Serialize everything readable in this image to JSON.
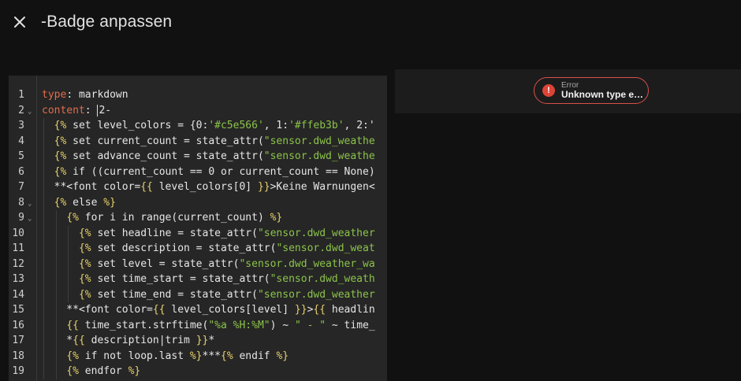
{
  "header": {
    "close_icon": "close-icon",
    "title": "-Badge anpassen"
  },
  "editor": {
    "lines": [
      {
        "num": "1",
        "fold": "",
        "segments": [
          {
            "c": "k",
            "t": "type"
          },
          {
            "c": "",
            "t": ": markdown"
          }
        ]
      },
      {
        "num": "2",
        "fold": "⌄",
        "segments": [
          {
            "c": "k",
            "t": "content"
          },
          {
            "c": "",
            "t": ": "
          },
          {
            "c": "cursor",
            "t": ""
          },
          {
            "c": "",
            "t": "2-"
          }
        ]
      },
      {
        "num": "3",
        "fold": "",
        "segments": [
          {
            "c": "",
            "t": "  "
          },
          {
            "c": "y",
            "t": "{%"
          },
          {
            "c": "",
            "t": " set level_colors = {0:"
          },
          {
            "c": "s",
            "t": "'#c5e566'"
          },
          {
            "c": "",
            "t": ", 1:"
          },
          {
            "c": "s",
            "t": "'#ffeb3b'"
          },
          {
            "c": "",
            "t": ", 2:'"
          }
        ]
      },
      {
        "num": "4",
        "fold": "",
        "segments": [
          {
            "c": "",
            "t": "  "
          },
          {
            "c": "y",
            "t": "{%"
          },
          {
            "c": "",
            "t": " set current_count = state_attr("
          },
          {
            "c": "s",
            "t": "\"sensor.dwd_weathe"
          }
        ]
      },
      {
        "num": "5",
        "fold": "",
        "segments": [
          {
            "c": "",
            "t": "  "
          },
          {
            "c": "y",
            "t": "{%"
          },
          {
            "c": "",
            "t": " set advance_count = state_attr("
          },
          {
            "c": "s",
            "t": "\"sensor.dwd_weathe"
          }
        ]
      },
      {
        "num": "6",
        "fold": "",
        "segments": [
          {
            "c": "",
            "t": "  "
          },
          {
            "c": "y",
            "t": "{%"
          },
          {
            "c": "",
            "t": " if ((current_count == 0 or current_count == None)"
          }
        ]
      },
      {
        "num": "7",
        "fold": "",
        "segments": [
          {
            "c": "",
            "t": "  **<font color="
          },
          {
            "c": "y",
            "t": "{{"
          },
          {
            "c": "",
            "t": " level_colors[0] "
          },
          {
            "c": "y",
            "t": "}}"
          },
          {
            "c": "",
            "t": ">Keine Warnungen<"
          }
        ]
      },
      {
        "num": "8",
        "fold": "⌄",
        "segments": [
          {
            "c": "",
            "t": "  "
          },
          {
            "c": "y",
            "t": "{%"
          },
          {
            "c": "",
            "t": " else "
          },
          {
            "c": "y",
            "t": "%}"
          }
        ]
      },
      {
        "num": "9",
        "fold": "⌄",
        "segments": [
          {
            "c": "",
            "t": "    "
          },
          {
            "c": "y",
            "t": "{%"
          },
          {
            "c": "",
            "t": " for i in range(current_count) "
          },
          {
            "c": "y",
            "t": "%}"
          }
        ]
      },
      {
        "num": "10",
        "fold": "",
        "segments": [
          {
            "c": "",
            "t": "      "
          },
          {
            "c": "y",
            "t": "{%"
          },
          {
            "c": "",
            "t": " set headline = state_attr("
          },
          {
            "c": "s",
            "t": "\"sensor.dwd_weather"
          }
        ]
      },
      {
        "num": "11",
        "fold": "",
        "segments": [
          {
            "c": "",
            "t": "      "
          },
          {
            "c": "y",
            "t": "{%"
          },
          {
            "c": "",
            "t": " set description = state_attr("
          },
          {
            "c": "s",
            "t": "\"sensor.dwd_weat"
          }
        ]
      },
      {
        "num": "12",
        "fold": "",
        "segments": [
          {
            "c": "",
            "t": "      "
          },
          {
            "c": "y",
            "t": "{%"
          },
          {
            "c": "",
            "t": " set level = state_attr("
          },
          {
            "c": "s",
            "t": "\"sensor.dwd_weather_wa"
          }
        ]
      },
      {
        "num": "13",
        "fold": "",
        "segments": [
          {
            "c": "",
            "t": "      "
          },
          {
            "c": "y",
            "t": "{%"
          },
          {
            "c": "",
            "t": " set time_start = state_attr("
          },
          {
            "c": "s",
            "t": "\"sensor.dwd_weath"
          }
        ]
      },
      {
        "num": "14",
        "fold": "",
        "segments": [
          {
            "c": "",
            "t": "      "
          },
          {
            "c": "y",
            "t": "{%"
          },
          {
            "c": "",
            "t": " set time_end = state_attr("
          },
          {
            "c": "s",
            "t": "\"sensor.dwd_weather"
          }
        ]
      },
      {
        "num": "15",
        "fold": "",
        "segments": [
          {
            "c": "",
            "t": "    **<font color="
          },
          {
            "c": "y",
            "t": "{{"
          },
          {
            "c": "",
            "t": " level_colors[level] "
          },
          {
            "c": "y",
            "t": "}}"
          },
          {
            "c": "",
            "t": ">"
          },
          {
            "c": "y",
            "t": "{{"
          },
          {
            "c": "",
            "t": " headlin"
          }
        ]
      },
      {
        "num": "16",
        "fold": "",
        "segments": [
          {
            "c": "",
            "t": "    "
          },
          {
            "c": "y",
            "t": "{{"
          },
          {
            "c": "",
            "t": " time_start.strftime("
          },
          {
            "c": "s",
            "t": "\"%a %H:%M\""
          },
          {
            "c": "",
            "t": ") ~ "
          },
          {
            "c": "s",
            "t": "\" - \""
          },
          {
            "c": "",
            "t": " ~ time_"
          }
        ]
      },
      {
        "num": "17",
        "fold": "",
        "segments": [
          {
            "c": "",
            "t": "    *"
          },
          {
            "c": "y",
            "t": "{{"
          },
          {
            "c": "",
            "t": " description|trim "
          },
          {
            "c": "y",
            "t": "}}"
          },
          {
            "c": "",
            "t": "*"
          }
        ]
      },
      {
        "num": "18",
        "fold": "",
        "segments": [
          {
            "c": "",
            "t": "    "
          },
          {
            "c": "y",
            "t": "{%"
          },
          {
            "c": "",
            "t": " if not loop.last "
          },
          {
            "c": "y",
            "t": "%}"
          },
          {
            "c": "",
            "t": "***"
          },
          {
            "c": "y",
            "t": "{%"
          },
          {
            "c": "",
            "t": " endif "
          },
          {
            "c": "y",
            "t": "%}"
          }
        ]
      },
      {
        "num": "19",
        "fold": "",
        "segments": [
          {
            "c": "",
            "t": "    "
          },
          {
            "c": "y",
            "t": "{%"
          },
          {
            "c": "",
            "t": " endfor "
          },
          {
            "c": "y",
            "t": "%}"
          }
        ]
      }
    ]
  },
  "preview": {
    "badge": {
      "icon": "alert-circle-icon",
      "label": "Error",
      "message": "Unknown type e…",
      "color": "#db4437"
    }
  },
  "colors": {
    "background": "#111111",
    "editor_bg": "#262626",
    "key": "#e06c4c",
    "string": "#8bc34a",
    "template_delim": "#e8d16b"
  }
}
